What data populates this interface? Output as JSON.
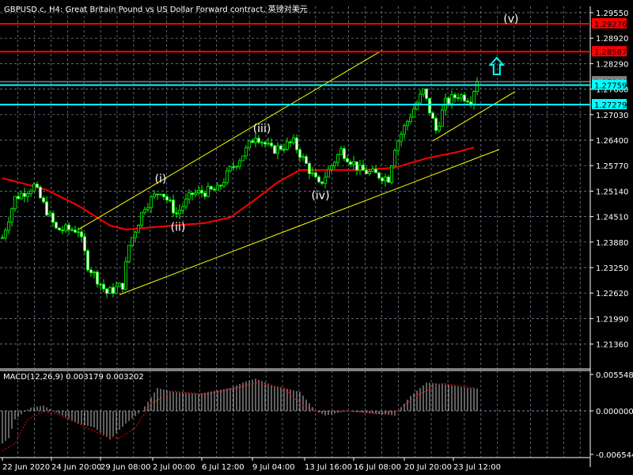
{
  "header": {
    "title": "GBPUSD.c, H4:  Great Britain Pound vs US Dollar Forward contract, 英镑对美元"
  },
  "colors": {
    "bull": "#00ff00",
    "ma": "#ff0000",
    "channel": "#ffff00",
    "level_red": "#ff0000",
    "level_cyan": "#00ffff",
    "grid": "#7f8fa6",
    "macd_hist": "#c0c0c0",
    "macd_signal": "#ff0000"
  },
  "chart_data": {
    "type": "candlestick",
    "symbol": "GBPUSD.c",
    "timeframe": "H4",
    "price_range": [
      1.2105,
      1.299
    ],
    "price_ticks": [
      "1.29550",
      "1.28920",
      "1.28290",
      "1.27660",
      "1.27030",
      "1.26400",
      "1.25770",
      "1.25140",
      "1.24510",
      "1.23880",
      "1.23250",
      "1.22620",
      "1.21990",
      "1.21360"
    ],
    "bar_count": 151,
    "price_path": [
      [
        0,
        1.2399
      ],
      [
        4,
        1.2497
      ],
      [
        10,
        1.2527
      ],
      [
        17,
        1.2419
      ],
      [
        24,
        1.2419
      ],
      [
        27,
        1.2331
      ],
      [
        33,
        1.2262
      ],
      [
        38,
        1.2282
      ],
      [
        40,
        1.238
      ],
      [
        45,
        1.2478
      ],
      [
        50,
        1.2517
      ],
      [
        55,
        1.2458
      ],
      [
        60,
        1.2507
      ],
      [
        68,
        1.2517
      ],
      [
        72,
        1.2566
      ],
      [
        77,
        1.2615
      ],
      [
        80,
        1.2654
      ],
      [
        85,
        1.2615
      ],
      [
        92,
        1.2634
      ],
      [
        97,
        1.2566
      ],
      [
        100,
        1.2527
      ],
      [
        107,
        1.2615
      ],
      [
        113,
        1.2566
      ],
      [
        122,
        1.2546
      ],
      [
        124,
        1.2624
      ],
      [
        129,
        1.2703
      ],
      [
        133,
        1.2761
      ],
      [
        137,
        1.2664
      ],
      [
        140,
        1.2732
      ],
      [
        144,
        1.2752
      ],
      [
        148,
        1.2742
      ],
      [
        150,
        1.2791
      ]
    ],
    "moving_average": [
      [
        0,
        1.2546
      ],
      [
        7,
        1.2532
      ],
      [
        14,
        1.2517
      ],
      [
        24,
        1.2478
      ],
      [
        34,
        1.2429
      ],
      [
        39,
        1.2419
      ],
      [
        54,
        1.2429
      ],
      [
        64,
        1.2435
      ],
      [
        72,
        1.2449
      ],
      [
        79,
        1.2488
      ],
      [
        87,
        1.2536
      ],
      [
        94,
        1.2566
      ],
      [
        104,
        1.2566
      ],
      [
        114,
        1.2566
      ],
      [
        124,
        1.2572
      ],
      [
        134,
        1.2595
      ],
      [
        144,
        1.2611
      ],
      [
        149,
        1.2622
      ]
    ],
    "levels": [
      {
        "label": "1.29276",
        "price": 1.29276,
        "color": "#ff0000"
      },
      {
        "label": "1.28587",
        "price": 1.28587,
        "color": "#ff0000"
      },
      {
        "label": "1.27759",
        "price": 1.27759,
        "color": "#00ffff"
      },
      {
        "label": "1.27279",
        "price": 1.27279,
        "color": "#00ffff"
      }
    ],
    "current_price": {
      "label": "1.27846",
      "price": 1.27846
    },
    "trendlines": [
      [
        [
          24,
          1.2419
        ],
        [
          120,
          1.2862
        ]
      ],
      [
        [
          37,
          1.2258
        ],
        [
          157,
          1.2617
        ]
      ],
      [
        [
          136,
          1.2638
        ],
        [
          162,
          1.276
        ]
      ]
    ],
    "wave_labels": [
      {
        "text": "(i)",
        "bar": 50,
        "price": 1.2535
      },
      {
        "text": "(ii)",
        "bar": 55.5,
        "price": 1.2416
      },
      {
        "text": "(iii)",
        "bar": 82,
        "price": 1.266
      },
      {
        "text": "(iv)",
        "bar": 100.5,
        "price": 1.2494
      },
      {
        "text": "(v)",
        "bar": 160.7,
        "price": 1.2931
      }
    ],
    "arrow": {
      "direction": "up",
      "bar": 156.2,
      "price": 1.2822
    },
    "time_labels": [
      {
        "text": "22 Jun 2020",
        "bar": 0
      },
      {
        "text": "24 Jun 20:00",
        "bar": 15.5
      },
      {
        "text": "29 Jun 08:00",
        "bar": 31
      },
      {
        "text": "2 Jul 00:00",
        "bar": 47.5
      },
      {
        "text": "6 Jul 12:00",
        "bar": 63
      },
      {
        "text": "9 Jul 04:00",
        "bar": 79
      },
      {
        "text": "13 Jul 16:00",
        "bar": 95.5
      },
      {
        "text": "16 Jul 08:00",
        "bar": 111
      },
      {
        "text": "20 Jul 20:00",
        "bar": 127
      },
      {
        "text": "23 Jul 12:00",
        "bar": 142.5
      }
    ],
    "macd": {
      "title": "MACD(12,26,9) 0.003179 0.003202",
      "range": [
        -0.006544,
        0.005548
      ],
      "ticks": [
        "0.005548",
        "0.000000",
        "-0.006544"
      ],
      "histogram": [
        [
          0,
          -0.0049
        ],
        [
          2,
          -0.0041
        ],
        [
          4,
          -0.0013
        ],
        [
          7,
          -0.0001
        ],
        [
          9,
          0.0005
        ],
        [
          13,
          0.0008
        ],
        [
          16,
          0
        ],
        [
          19,
          -0.0007
        ],
        [
          24,
          -0.0019
        ],
        [
          29,
          -0.0025
        ],
        [
          34,
          -0.0043
        ],
        [
          39,
          -0.0019
        ],
        [
          44,
          0
        ],
        [
          49,
          0.0035
        ],
        [
          54,
          0.0029
        ],
        [
          62,
          0.0026
        ],
        [
          72,
          0.0035
        ],
        [
          77,
          0.0045
        ],
        [
          80,
          0.0049
        ],
        [
          86,
          0.0038
        ],
        [
          94,
          0.0029
        ],
        [
          99,
          0
        ],
        [
          102,
          -0.0007
        ],
        [
          109,
          0
        ],
        [
          117,
          -0.0004
        ],
        [
          124,
          -0.0007
        ],
        [
          129,
          0.0023
        ],
        [
          134,
          0.0043
        ],
        [
          139,
          0.0041
        ],
        [
          147,
          0.0035
        ],
        [
          150,
          0.0034
        ]
      ],
      "signal": [
        [
          0,
          -0.006
        ],
        [
          4,
          -0.0049
        ],
        [
          8,
          -0.0013
        ],
        [
          13,
          -0.0001
        ],
        [
          17,
          -0.0004
        ],
        [
          24,
          -0.0019
        ],
        [
          32,
          -0.0037
        ],
        [
          37,
          -0.0041
        ],
        [
          42,
          -0.0025
        ],
        [
          47,
          0.0011
        ],
        [
          54,
          0.003
        ],
        [
          64,
          0.0025
        ],
        [
          74,
          0.0035
        ],
        [
          80,
          0.0043
        ],
        [
          89,
          0.0035
        ],
        [
          94,
          0.0011
        ],
        [
          99,
          -0.0001
        ],
        [
          109,
          0
        ],
        [
          119,
          -0.0004
        ],
        [
          124,
          -0.0001
        ],
        [
          132,
          0.0026
        ],
        [
          139,
          0.0042
        ],
        [
          149,
          0.0035
        ]
      ]
    }
  }
}
